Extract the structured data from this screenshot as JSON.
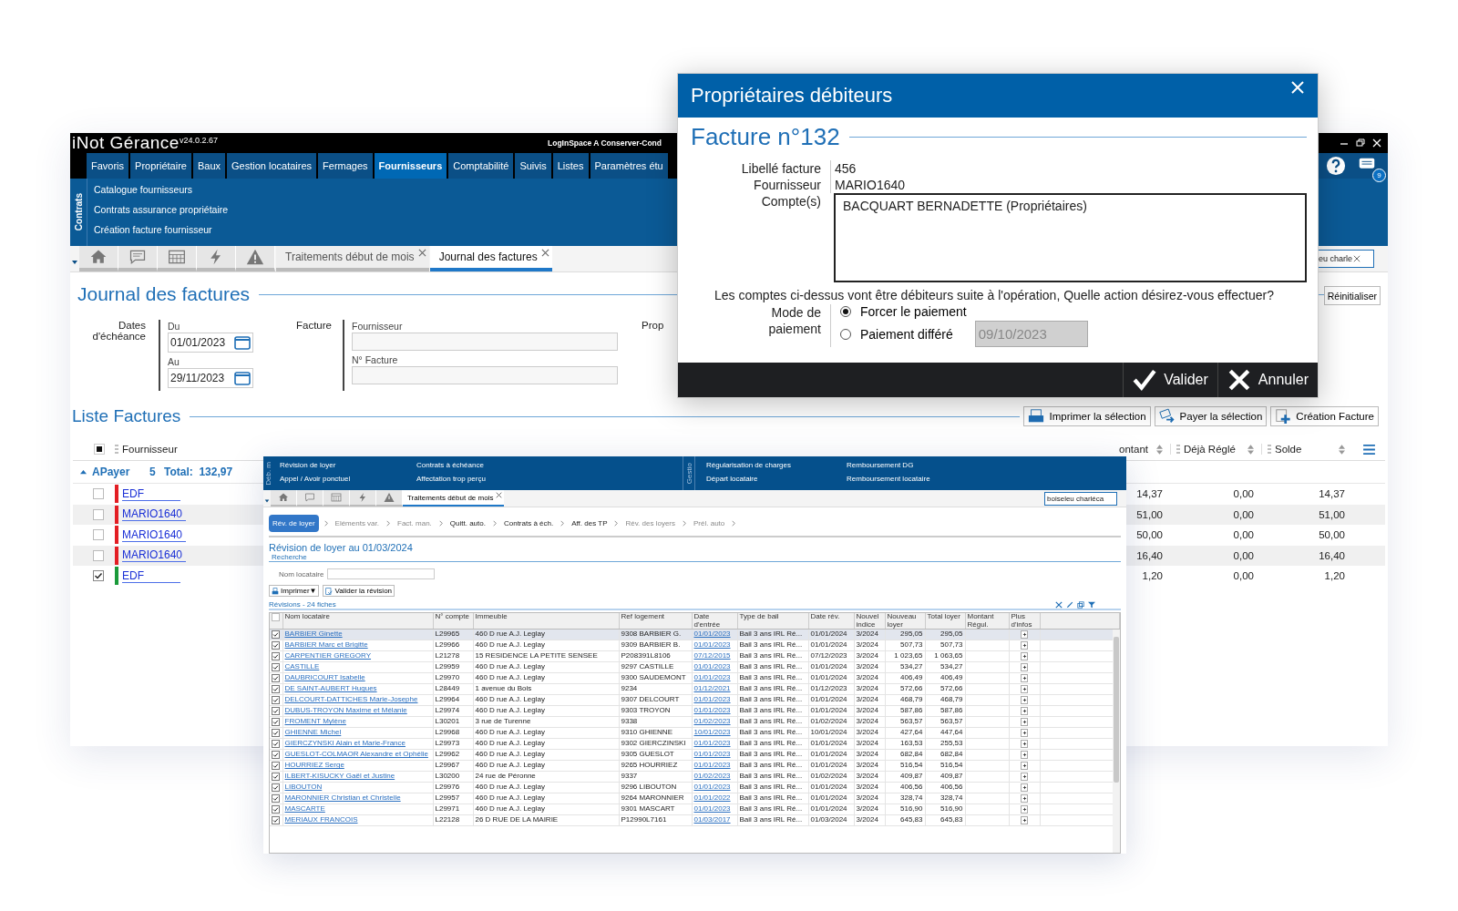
{
  "main_window": {
    "app_name": "iNot Gérance",
    "version": "v24.0.2.67",
    "session": "LogInSpace A Conserver-Cond",
    "notification_count": "9",
    "menu": [
      {
        "label": "Favoris",
        "selected": false
      },
      {
        "label": "Propriétaire",
        "selected": false
      },
      {
        "label": "Baux",
        "selected": false
      },
      {
        "label": "Gestion locataires",
        "selected": false
      },
      {
        "label": "Fermages",
        "selected": false
      },
      {
        "label": "Fournisseurs",
        "selected": true
      },
      {
        "label": "Comptabilité",
        "selected": false
      },
      {
        "label": "Suivis",
        "selected": false
      },
      {
        "label": "Listes",
        "selected": false
      },
      {
        "label": "Paramètres étu",
        "selected": false
      }
    ],
    "submenu": {
      "group": "Contrats",
      "items": [
        "Catalogue fournisseurs",
        "Contrats assurance propriétaire",
        "Création facture fournisseur"
      ]
    },
    "tabs": [
      {
        "label": "Traitements début de mois",
        "selected": false
      },
      {
        "label": "Journal des factures",
        "selected": true
      }
    ],
    "search": {
      "value": "eu charle"
    },
    "page_title": "Journal des factures",
    "filters": {
      "due_dates_label": "Dates d'échéance",
      "from_label": "Du",
      "from": "01/01/2023",
      "to_label": "Au",
      "to": "29/11/2023",
      "invoice_label": "Facture",
      "supplier_label": "Fournisseur",
      "invoice_no_label": "N° Facture",
      "owner_label": "Prop",
      "reset_button": "Réinitialiser"
    },
    "list": {
      "title": "Liste Factures",
      "actions": [
        {
          "label": "Imprimer la sélection",
          "kind": "print"
        },
        {
          "label": "Payer la sélection",
          "kind": "pay"
        },
        {
          "label": "Création Facture",
          "kind": "create"
        }
      ],
      "columns": {
        "supplier": "Fournisseur",
        "amount": "ontant",
        "paid": "Déjà Réglé",
        "balance": "Solde"
      },
      "select_all_partial": true,
      "group": {
        "label": "APayer",
        "count": "5",
        "total": "Total:  132,97",
        "expanded": true
      },
      "rows": [
        {
          "supplier": "EDF",
          "color": "#e31e24",
          "checked": false,
          "amount": "14,37",
          "paid": "0,00",
          "balance": "14,37"
        },
        {
          "supplier": "MARIO1640",
          "color": "#e31e24",
          "checked": false,
          "amount": "51,00",
          "paid": "0,00",
          "balance": "51,00"
        },
        {
          "supplier": "MARIO1640",
          "color": "#e31e24",
          "checked": false,
          "amount": "50,00",
          "paid": "0,00",
          "balance": "50,00"
        },
        {
          "supplier": "MARIO1640",
          "color": "#e31e24",
          "checked": false,
          "amount": "16,40",
          "paid": "0,00",
          "balance": "16,40"
        },
        {
          "supplier": "EDF",
          "color": "#1a9a3a",
          "checked": true,
          "amount": "1,20",
          "paid": "0,00",
          "balance": "1,20"
        }
      ]
    }
  },
  "front_window": {
    "side_labels": [
      "Déb. m",
      "Gestio"
    ],
    "menu_columns": [
      [
        "Révision de loyer",
        "Appel / Avoir ponctuel"
      ],
      [
        "Contrats à échéance",
        "Affectation trop perçu"
      ],
      [
        "Régularisation de charges",
        "Départ locataire"
      ],
      [
        "Remboursement DG",
        "Remboursement locataire"
      ]
    ],
    "tabs": [
      {
        "label": "Traitements début de mois",
        "selected": true
      }
    ],
    "search": {
      "value": "boiseleu charléca"
    },
    "steps": [
      {
        "label": "Rév. de loyer",
        "selected": true,
        "enabled": true
      },
      {
        "label": "Eléments var.",
        "selected": false,
        "enabled": false
      },
      {
        "label": "Fact. man.",
        "selected": false,
        "enabled": false
      },
      {
        "label": "Quitt. auto.",
        "selected": false,
        "enabled": true
      },
      {
        "label": "Contrats à éch.",
        "selected": false,
        "enabled": true
      },
      {
        "label": "Aff. des TP",
        "selected": false,
        "enabled": true
      },
      {
        "label": "Rév. des loyers",
        "selected": false,
        "enabled": false
      },
      {
        "label": "Prél. auto",
        "selected": false,
        "enabled": false
      }
    ],
    "title": "Révision de loyer au 01/03/2024",
    "search_section": "Recherche",
    "tenant_label": "Nom locataire",
    "buttons": [
      {
        "label": "Imprimer▼",
        "kind": "print"
      },
      {
        "label": "Valider la révision",
        "kind": "validate"
      }
    ],
    "list_title": "Révisions - 24 fiches",
    "select_all_checked": false,
    "columns": [
      "Nom locataire",
      "N° compte",
      "Immeuble",
      "Ref logement",
      "Date d'entrée",
      "Type de bail",
      "Date rév.",
      "Nouvel indice",
      "Nouveau loyer",
      "Total loyer",
      "Montant Régul.",
      "Plus d'infos"
    ],
    "rows": [
      {
        "selected": true,
        "checked": true,
        "cells": [
          "BARBIER Ginette",
          "L29965",
          "460 D rue A.J.  Leglay",
          "9308 BARBIER G.",
          "01/01/2023",
          "Bail 3 ans IRL Ré...",
          "01/01/2024",
          "3/2024",
          "295,05",
          "295,05"
        ]
      },
      {
        "selected": false,
        "checked": true,
        "cells": [
          "BARBIER Marc et Brigitte",
          "L29966",
          "460 D rue A.J.  Leglay",
          "9309 BARBIER B.",
          "01/01/2023",
          "Bail 3 ans IRL Ré...",
          "01/01/2024",
          "3/2024",
          "507,73",
          "507,73"
        ]
      },
      {
        "selected": false,
        "checked": true,
        "cells": [
          "CARPENTIER GREGORY",
          "L21278",
          "15 RESIDENCE LA PETITE SENSEE",
          "P208391L8106",
          "07/12/2015",
          "Bail 3 ans IRL Ré...",
          "07/12/2023",
          "3/2024",
          "1 023,65",
          "1 063,65"
        ]
      },
      {
        "selected": false,
        "checked": true,
        "cells": [
          "CASTILLE",
          "L29959",
          "460 D rue A.J.  Leglay",
          "9297 CASTILLE",
          "01/01/2023",
          "Bail 3 ans IRL Ré...",
          "01/01/2024",
          "3/2024",
          "534,27",
          "534,27"
        ]
      },
      {
        "selected": false,
        "checked": true,
        "cells": [
          "DAUBRICOURT Isabelle",
          "L29970",
          "460 D rue A.J.  Leglay",
          "9300 SAUDEMONT",
          "01/01/2023",
          "Bail 3 ans IRL Ré...",
          "01/01/2024",
          "3/2024",
          "406,49",
          "406,49"
        ]
      },
      {
        "selected": false,
        "checked": true,
        "cells": [
          "DE SAINT-AUBERT Hugues",
          "L28449",
          "1 avenue du Bois",
          "9234",
          "01/12/2021",
          "Bail 3 ans IRL Ré...",
          "01/12/2023",
          "3/2024",
          "572,66",
          "572,66"
        ]
      },
      {
        "selected": false,
        "checked": true,
        "cells": [
          "DELCOURT-DATTICHES Marie-Josephe",
          "L29964",
          "460 D rue A.J.  Leglay",
          "9307 DELCOURT",
          "01/01/2023",
          "Bail 3 ans IRL Ré...",
          "01/01/2024",
          "3/2024",
          "468,79",
          "468,79"
        ]
      },
      {
        "selected": false,
        "checked": true,
        "cells": [
          "DUBUS-TROYON Maxime et Mélanie",
          "L29974",
          "460 D rue A.J.  Leglay",
          "9303 TROYON",
          "01/01/2023",
          "Bail 3 ans IRL Ré...",
          "01/01/2024",
          "3/2024",
          "587,86",
          "587,86"
        ]
      },
      {
        "selected": false,
        "checked": true,
        "cells": [
          "FROMENT Mylène",
          "L30201",
          "3 rue de Turenne",
          "9338",
          "01/02/2023",
          "Bail 3 ans IRL Ré...",
          "01/02/2024",
          "3/2024",
          "563,57",
          "563,57"
        ]
      },
      {
        "selected": false,
        "checked": true,
        "cells": [
          "GHIENNE Michel",
          "L29968",
          "460 D rue A.J.  Leglay",
          "9310 GHIENNE",
          "10/01/2023",
          "Bail 3 ans IRL Ré...",
          "10/01/2024",
          "3/2024",
          "427,64",
          "447,64"
        ]
      },
      {
        "selected": false,
        "checked": true,
        "cells": [
          "GIERCZYNSKI Alain et Marie-France",
          "L29973",
          "460 D rue A.J.  Leglay",
          "9302 GIERCZINSKI",
          "01/01/2023",
          "Bail 3 ans IRL Ré...",
          "01/01/2024",
          "3/2024",
          "163,53",
          "255,53"
        ]
      },
      {
        "selected": false,
        "checked": true,
        "cells": [
          "GUESLOT-COLMAOR Alexandre et Ophélie",
          "L29962",
          "460 D rue A.J.  Leglay",
          "9305 GUESLOT",
          "01/01/2023",
          "Bail 3 ans IRL Ré...",
          "01/01/2024",
          "3/2024",
          "682,84",
          "682,84"
        ]
      },
      {
        "selected": false,
        "checked": true,
        "cells": [
          "HOURRIEZ Serge",
          "L29967",
          "460 D rue A.J.  Leglay",
          "9265 HOURRIEZ",
          "01/01/2023",
          "Bail 3 ans IRL Ré...",
          "01/01/2024",
          "3/2024",
          "516,54",
          "516,54"
        ]
      },
      {
        "selected": false,
        "checked": true,
        "cells": [
          "ILBERT-KISUCKY Gaël et Justine",
          "L30200",
          "24 rue de Péronne",
          "9337",
          "01/02/2023",
          "Bail 3 ans IRL Ré...",
          "01/02/2024",
          "3/2024",
          "409,87",
          "409,87"
        ]
      },
      {
        "selected": false,
        "checked": true,
        "cells": [
          "LIBOUTON",
          "L29976",
          "460 D rue A.J.  Leglay",
          "9296 LIBOUTON",
          "01/01/2023",
          "Bail 3 ans IRL Ré...",
          "01/01/2024",
          "3/2024",
          "406,56",
          "406,56"
        ]
      },
      {
        "selected": false,
        "checked": true,
        "cells": [
          "MARONNIER Christian et Christelle",
          "L29957",
          "460 D rue A.J.  Leglay",
          "9264 MARONNIER",
          "01/01/2022",
          "Bail 3 ans IRL Ré...",
          "01/01/2024",
          "3/2024",
          "328,74",
          "328,74"
        ]
      },
      {
        "selected": false,
        "checked": true,
        "cells": [
          "MASCARTE",
          "L29971",
          "460 D rue A.J.  Leglay",
          "9301 MASCART",
          "01/01/2023",
          "Bail 3 ans IRL Ré...",
          "01/01/2024",
          "3/2024",
          "516,90",
          "516,90"
        ]
      },
      {
        "selected": false,
        "checked": true,
        "cells": [
          "MERIAUX FRANCOIS",
          "L22128",
          "26 D RUE DE LA MAIRIE",
          "P12990L7161",
          "01/03/2017",
          "Bail 3 ans IRL Ré...",
          "01/03/2024",
          "3/2024",
          "645,83",
          "645,83"
        ]
      }
    ]
  },
  "dialog": {
    "title": "Propriétaires débiteurs",
    "heading": "Facture n°132",
    "fields": [
      {
        "label": "Libellé facture",
        "value": "456"
      },
      {
        "label": "Fournisseur",
        "value": "MARIO1640"
      }
    ],
    "accounts_label": "Compte(s)",
    "accounts": "BACQUART BERNADETTE (Propriétaires)",
    "question": "Les comptes ci-dessus vont être débiteurs suite à l'opération, Quelle action désirez-vous effectuer?",
    "payment_label": "Mode de paiement",
    "options": [
      {
        "label": "Forcer le paiement",
        "selected": true
      },
      {
        "label": "Paiement différé",
        "selected": false
      }
    ],
    "deferred_date": "09/10/2023",
    "buttons": [
      {
        "label": "Valider",
        "kind": "ok"
      },
      {
        "label": "Annuler",
        "kind": "cancel"
      }
    ]
  }
}
